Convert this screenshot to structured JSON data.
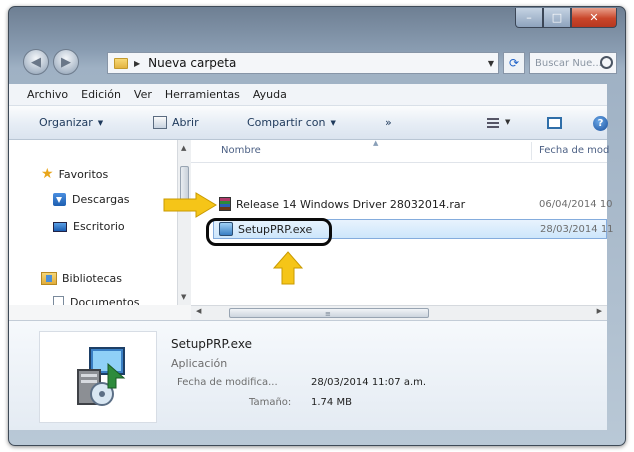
{
  "address": {
    "path": "Nueva carpeta"
  },
  "search": {
    "placeholder": "Buscar Nue..."
  },
  "menu": [
    "Archivo",
    "Edición",
    "Ver",
    "Herramientas",
    "Ayuda"
  ],
  "toolbar": {
    "organize": "Organizar",
    "open": "Abrir",
    "share": "Compartir con",
    "more": "»"
  },
  "nav": {
    "favorites": "Favoritos",
    "downloads": "Descargas",
    "desktop": "Escritorio",
    "libraries": "Bibliotecas",
    "documents": "Documentos"
  },
  "columns": {
    "name": "Nombre",
    "date": "Fecha de mod"
  },
  "files": [
    {
      "name": "Release 14 Windows Driver 28032014.rar",
      "date": "06/04/2014 10",
      "icon": "rar-archive-icon"
    },
    {
      "name": "SetupPRP.exe",
      "date": "28/03/2014 11",
      "icon": "setup-exe-icon",
      "selected": true
    }
  ],
  "details": {
    "name": "SetupPRP.exe",
    "type": "Aplicación",
    "modified_label": "Fecha de modifica...",
    "modified_value": "28/03/2014 11:07 a.m.",
    "size_label": "Tamaño:",
    "size_value": "1.74 MB"
  },
  "colors": {
    "annotation_arrow": "#f5c518",
    "selection": "#cde6fb",
    "titlebar": "#8a9db2"
  }
}
